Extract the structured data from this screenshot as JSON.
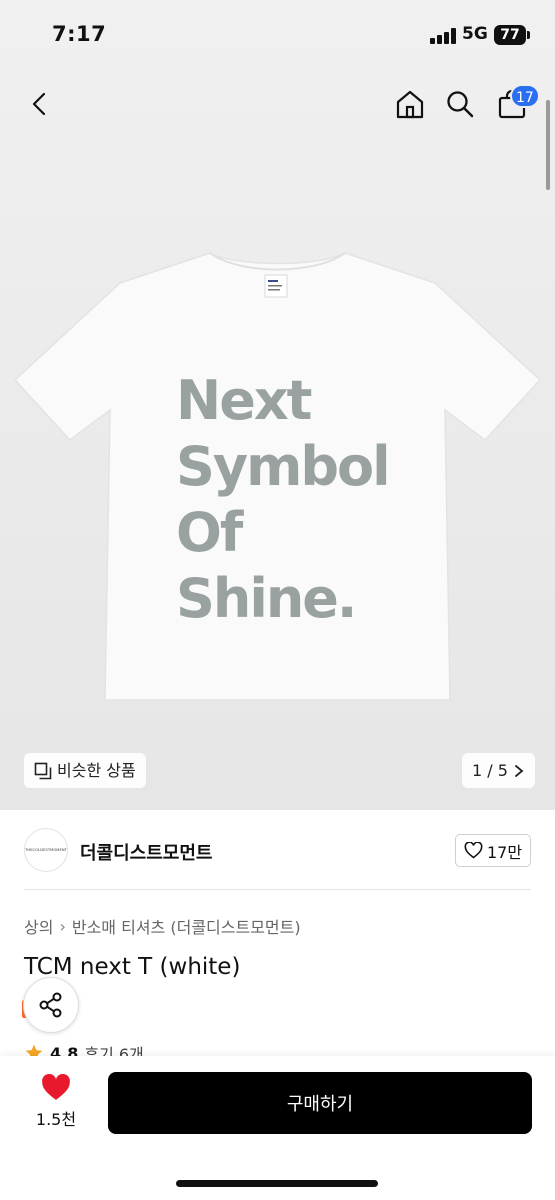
{
  "status_bar": {
    "time": "7:17",
    "network": "5G",
    "battery": "77"
  },
  "nav": {
    "cart_count": "17",
    "icons": [
      "back-icon",
      "home-icon",
      "search-icon",
      "cart-icon"
    ]
  },
  "product_image": {
    "lines": [
      "Next",
      "Symbol",
      "Of",
      "Shine."
    ],
    "neck_label": "TCM"
  },
  "similar_chip": {
    "label": "비슷한 상품"
  },
  "image_pager": {
    "label": "1 / 5"
  },
  "brand": {
    "logo_text": "THECOLDESTMOMENT",
    "name": "더콜디스트모먼트",
    "likes": "17만"
  },
  "breadcrumb": {
    "category": "상의",
    "subcategory": "반소매 티셔츠 (더콜디스트모먼트)"
  },
  "product": {
    "title": "TCM next T (white)"
  },
  "rating": {
    "score": "4.8",
    "reviews_label": "후기 6개"
  },
  "bottom_bar": {
    "wish_count": "1.5천",
    "buy_label": "구매하기"
  },
  "colors": {
    "accent_blue": "#2a6ef2",
    "heart_red": "#e8192c",
    "shirt_print": "#9aa2a1",
    "buy_button": "#000000"
  }
}
